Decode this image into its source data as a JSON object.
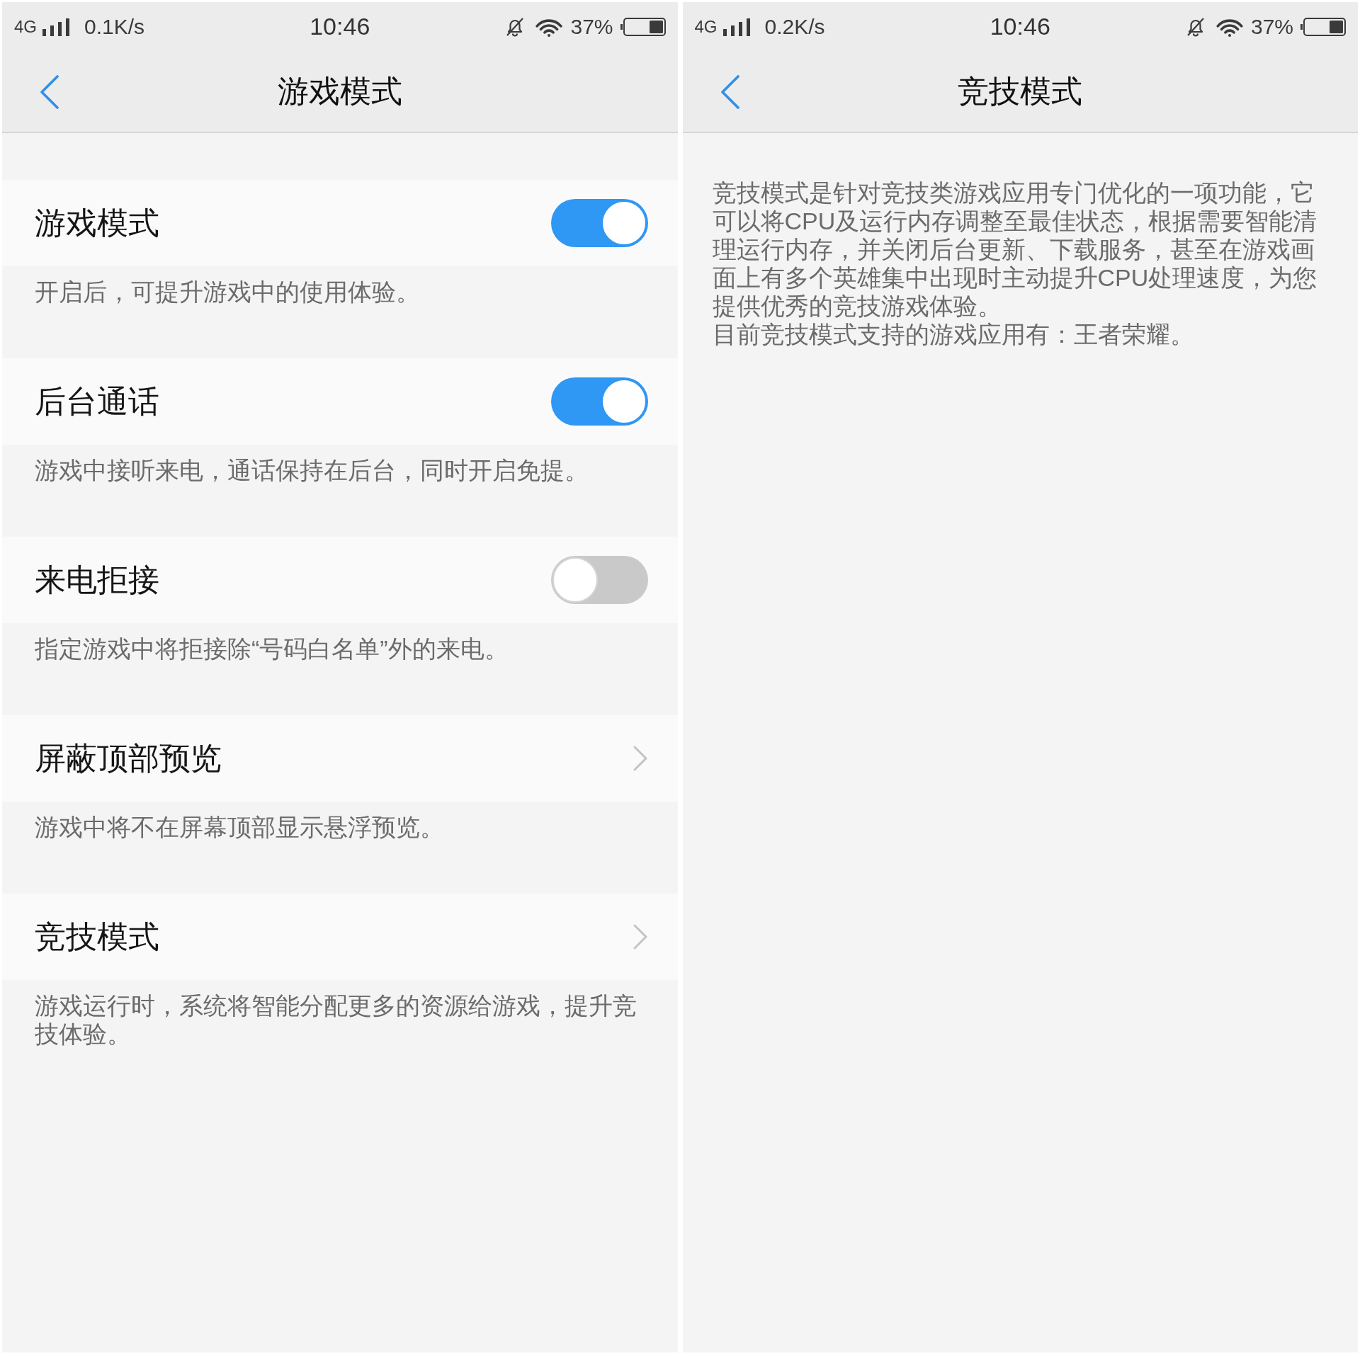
{
  "panels": [
    {
      "status_bar": {
        "network": "4G",
        "speed": "0.1K/s",
        "time": "10:46",
        "battery": "37%"
      },
      "title": "游戏模式",
      "items": [
        {
          "kind": "toggle",
          "label": "游戏模式",
          "on": true,
          "description": "开启后，可提升游戏中的使用体验。"
        },
        {
          "kind": "toggle",
          "label": "后台通话",
          "on": true,
          "description": "游戏中接听来电，通话保持在后台，同时开启免提。"
        },
        {
          "kind": "toggle",
          "label": "来电拒接",
          "on": false,
          "description": "指定游戏中将拒接除“号码白名单”外的来电。"
        },
        {
          "kind": "link",
          "label": "屏蔽顶部预览",
          "description": "游戏中将不在屏幕顶部显示悬浮预览。"
        },
        {
          "kind": "link",
          "label": "竞技模式",
          "description": "游戏运行时，系统将智能分配更多的资源给游戏，提升竞技体验。"
        }
      ]
    },
    {
      "status_bar": {
        "network": "4G",
        "speed": "0.2K/s",
        "time": "10:46",
        "battery": "37%"
      },
      "title": "竞技模式",
      "paragraphs": [
        "竞技模式是针对竞技类游戏应用专门优化的一项功能，它可以将CPU及运行内存调整至最佳状态，根据需要智能清理运行内存，并关闭后台更新、下载服务，甚至在游戏画面上有多个英雄集中出现时主动提升CPU处理速度，为您提供优秀的竞技游戏体验。",
        "目前竞技模式支持的游戏应用有：王者荣耀。"
      ]
    }
  ]
}
